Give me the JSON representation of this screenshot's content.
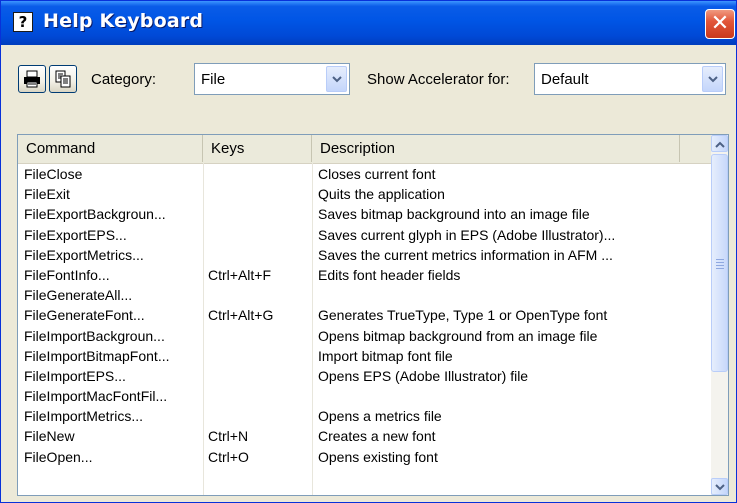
{
  "window": {
    "title": "Help Keyboard",
    "title_icon": "?",
    "close_symbol": "✕",
    "colors": {
      "titlebar": "#0055e5",
      "close": "#e2573a",
      "face": "#ece9d8"
    }
  },
  "toolbar": {
    "print_button": {
      "icon": "printer-icon"
    },
    "copy_button": {
      "icon": "copy-icon"
    },
    "category_label": "Category:",
    "category_value": "File",
    "accelerator_label": "Show Accelerator for:",
    "accelerator_value": "Default"
  },
  "table": {
    "columns": [
      "Command",
      "Keys",
      "Description",
      ""
    ],
    "rows": [
      {
        "command": "FileClose",
        "keys": "",
        "description": "Closes current font"
      },
      {
        "command": "FileExit",
        "keys": "",
        "description": "Quits the application"
      },
      {
        "command": "FileExportBackgroun...",
        "keys": "",
        "description": "Saves bitmap background into an image file"
      },
      {
        "command": "FileExportEPS...",
        "keys": "",
        "description": "Saves current glyph in EPS (Adobe Illustrator)..."
      },
      {
        "command": "FileExportMetrics...",
        "keys": "",
        "description": "Saves the current metrics information in AFM ..."
      },
      {
        "command": "FileFontInfo...",
        "keys": "Ctrl+Alt+F",
        "description": "Edits font header fields"
      },
      {
        "command": "FileGenerateAll...",
        "keys": "",
        "description": ""
      },
      {
        "command": "FileGenerateFont...",
        "keys": "Ctrl+Alt+G",
        "description": "Generates TrueType, Type 1 or OpenType font"
      },
      {
        "command": "FileImportBackgroun...",
        "keys": "",
        "description": "Opens bitmap background from an image file"
      },
      {
        "command": "FileImportBitmapFont...",
        "keys": "",
        "description": "Import bitmap font file"
      },
      {
        "command": "FileImportEPS...",
        "keys": "",
        "description": "Opens EPS (Adobe Illustrator) file"
      },
      {
        "command": "FileImportMacFontFil...",
        "keys": "",
        "description": ""
      },
      {
        "command": "FileImportMetrics...",
        "keys": "",
        "description": "Opens a metrics file"
      },
      {
        "command": "FileNew",
        "keys": "Ctrl+N",
        "description": "Creates a new font"
      },
      {
        "command": "FileOpen...",
        "keys": "Ctrl+O",
        "description": "Opens existing font"
      }
    ]
  }
}
